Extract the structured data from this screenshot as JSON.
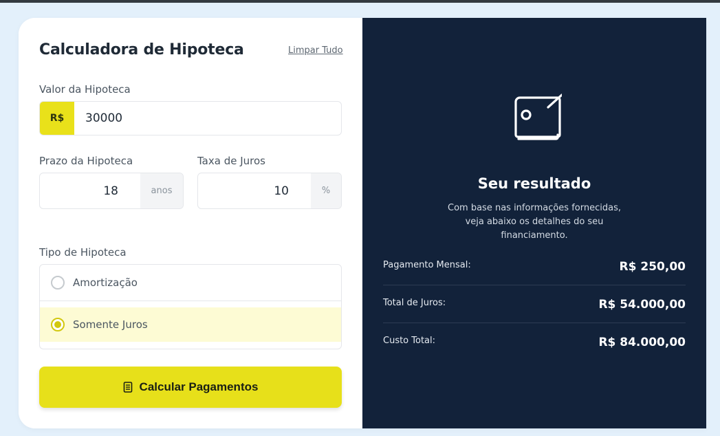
{
  "form": {
    "title": "Calculadora de Hipoteca",
    "clear_label": "Limpar Tudo",
    "amount_label": "Valor da Hipoteca",
    "currency_prefix": "R$",
    "amount_value": "30000",
    "term_label": "Prazo da Hipoteca",
    "term_value": "18",
    "term_unit": "anos",
    "rate_label": "Taxa de Juros",
    "rate_value": "10",
    "rate_unit": "%",
    "type_label": "Tipo de Hipoteca",
    "type_options": [
      {
        "label": "Amortização",
        "selected": false
      },
      {
        "label": "Somente Juros",
        "selected": true
      }
    ],
    "submit_label": "Calcular Pagamentos",
    "submit_icon": "document-icon"
  },
  "result": {
    "icon": "wallet-icon",
    "title": "Seu resultado",
    "description": "Com base nas informações fornecidas, veja abaixo os detalhes do seu financiamento.",
    "rows": [
      {
        "label": "Pagamento Mensal:",
        "value": "R$ 250,00"
      },
      {
        "label": "Total de Juros:",
        "value": "R$ 54.000,00"
      },
      {
        "label": "Custo Total:",
        "value": "R$ 84.000,00"
      }
    ]
  },
  "colors": {
    "accent": "#e7e01a",
    "panel": "#12223a",
    "background": "#e3f0fb"
  }
}
